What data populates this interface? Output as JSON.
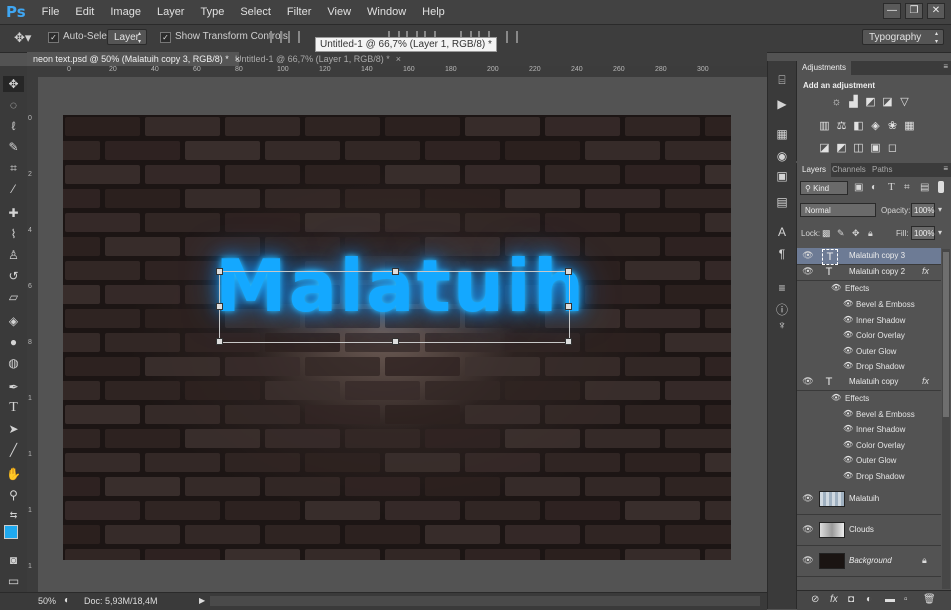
{
  "app": {
    "logo": "Ps"
  },
  "menu": [
    "File",
    "Edit",
    "Image",
    "Layer",
    "Type",
    "Select",
    "Filter",
    "View",
    "Window",
    "Help"
  ],
  "window_controls": [
    "—",
    "❐",
    "✕"
  ],
  "options_bar": {
    "auto_select_label": "Auto-Select:",
    "auto_select_value": "Layer",
    "show_transform_label": "Show Transform Controls",
    "workspace": "Typography",
    "tooltip": "Untitled-1 @ 66,7% (Layer 1, RGB/8) *"
  },
  "tabs": [
    {
      "label": "neon text.psd @ 50% (Malatuih copy 3, RGB/8) *",
      "close": "×"
    },
    {
      "label": "Untitled-1 @ 66,7% (Layer 1, RGB/8) *",
      "close": "×"
    }
  ],
  "ruler_top": [
    "0",
    "20",
    "40",
    "60",
    "80",
    "100",
    "120",
    "140",
    "160",
    "180",
    "200",
    "220",
    "240",
    "260",
    "280",
    "300"
  ],
  "ruler_left": [
    "0",
    "2",
    "4",
    "6",
    "8",
    "1",
    "1",
    "1",
    "1"
  ],
  "canvas": {
    "text": "Malatuih",
    "text_color": "#14a8ff"
  },
  "status": {
    "zoom": "50%",
    "doc": "Doc: 5,93M/18,4M"
  },
  "adjustments": {
    "tab": "Adjustments",
    "heading": "Add an adjustment",
    "icons_row1": [
      "brightness-icon",
      "levels-icon",
      "curves-icon",
      "exposure-icon",
      "vibrance-icon"
    ],
    "icons_row2": [
      "hue-saturation-icon",
      "color-balance-icon",
      "black-white-icon",
      "photo-filter-icon",
      "channel-mixer-icon",
      "color-lookup-icon"
    ],
    "icons_row3": [
      "invert-icon",
      "posterize-icon",
      "threshold-icon",
      "selective-color-icon",
      "gradient-map-icon"
    ]
  },
  "layers_panel": {
    "tabs": [
      "Layers",
      "Channels",
      "Paths"
    ],
    "kind": "Kind",
    "blend_mode": "Normal",
    "opacity_label": "Opacity:",
    "opacity": "100%",
    "lock_label": "Lock:",
    "fill_label": "Fill:",
    "fill": "100%",
    "layers": [
      {
        "name": "Malatuih copy 3",
        "type": "text"
      },
      {
        "name": "Malatuih copy 2",
        "type": "text",
        "fx": "fx",
        "effects_label": "Effects",
        "effects": [
          "Bevel & Emboss",
          "Inner Shadow",
          "Color Overlay",
          "Outer Glow",
          "Drop Shadow"
        ]
      },
      {
        "name": "Malatuih copy",
        "type": "text",
        "fx": "fx",
        "effects_label": "Effects",
        "effects": [
          "Bevel & Emboss",
          "Inner Shadow",
          "Color Overlay",
          "Outer Glow",
          "Drop Shadow"
        ]
      },
      {
        "name": "Malatuih",
        "type": "raster"
      },
      {
        "name": "Clouds",
        "type": "raster"
      },
      {
        "name": "Background",
        "type": "background"
      }
    ]
  }
}
